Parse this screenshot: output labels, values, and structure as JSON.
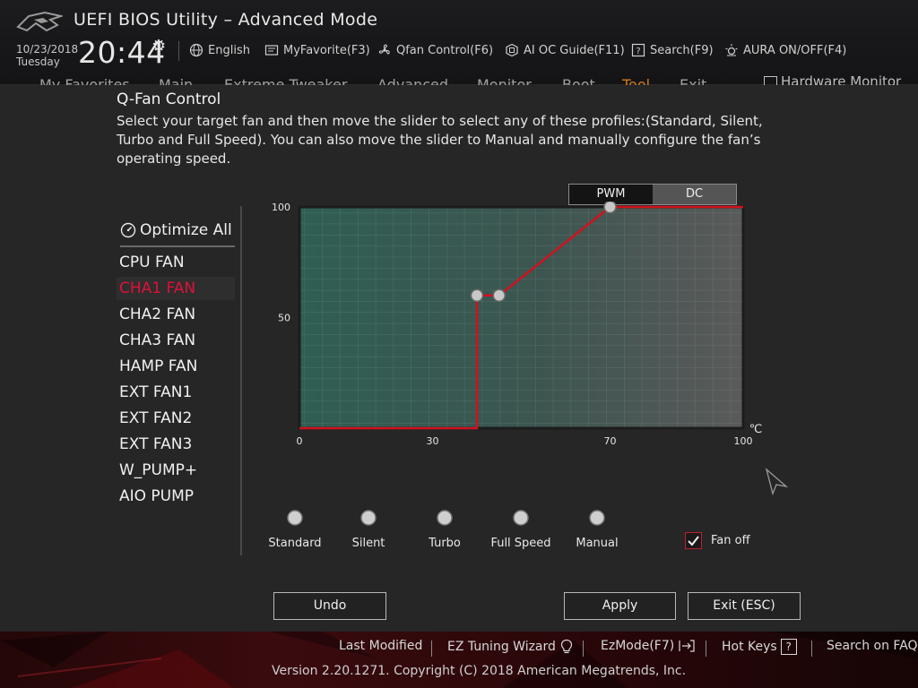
{
  "header": {
    "title": "UEFI BIOS Utility – Advanced Mode",
    "date": "10/23/2018",
    "day": "Tuesday",
    "time": "20:44",
    "tools": [
      {
        "label": "English",
        "icon": "globe-icon"
      },
      {
        "label": "MyFavorite(F3)",
        "icon": "favorite-icon"
      },
      {
        "label": "Qfan Control(F6)",
        "icon": "fan-icon"
      },
      {
        "label": "AI OC Guide(F11)",
        "icon": "ai-oc-icon"
      },
      {
        "label": "Search(F9)",
        "icon": "search-help-icon"
      },
      {
        "label": "AURA ON/OFF(F4)",
        "icon": "aura-icon"
      }
    ],
    "menu": [
      "My Favorites",
      "Main",
      "Extreme Tweaker",
      "Advanced",
      "Monitor",
      "Boot",
      "Tool",
      "Exit"
    ],
    "menu_active": "Tool",
    "hardware_monitor": "Hardware Monitor"
  },
  "qfan": {
    "title": "Q-Fan Control",
    "description": "Select your target fan and then move the slider to select any of these profiles:(Standard, Silent, Turbo and Full Speed). You can also move the slider to Manual and manually configure the fan’s operating speed.",
    "optimize_all": "Optimize All",
    "fans": [
      "CPU FAN",
      "CHA1 FAN",
      "CHA2 FAN",
      "CHA3 FAN",
      "HAMP FAN",
      "EXT FAN1",
      "EXT FAN2",
      "EXT FAN3",
      "W_PUMP+",
      "AIO PUMP"
    ],
    "selected_fan": "CHA1 FAN",
    "mode_options": [
      "PWM",
      "DC"
    ],
    "mode_selected": "PWM",
    "profiles": [
      "Standard",
      "Silent",
      "Turbo",
      "Full Speed",
      "Manual"
    ],
    "profile_selected": "Manual",
    "fan_off_label": "Fan off",
    "fan_off_checked": true,
    "undo": "Undo",
    "apply": "Apply",
    "exit": "Exit (ESC)"
  },
  "chart_data": {
    "type": "line",
    "xlabel": "℃",
    "ylabel": "%",
    "x_ticks": [
      "0",
      "30",
      "70",
      "100"
    ],
    "y_ticks": [
      "100",
      "50"
    ],
    "xlim": [
      0,
      100
    ],
    "ylim": [
      0,
      100
    ],
    "series": [
      {
        "points": [
          [
            0,
            0
          ],
          [
            40,
            0
          ],
          [
            40,
            60
          ],
          [
            45,
            60
          ],
          [
            70,
            100
          ],
          [
            100,
            100
          ]
        ]
      }
    ],
    "handles": [
      [
        40,
        60
      ],
      [
        45,
        60
      ],
      [
        70,
        100
      ]
    ],
    "colors": {
      "line": "#d0121e",
      "handle": "#c8c8c8"
    }
  },
  "footer": {
    "links": [
      "Last Modified",
      "EZ Tuning Wizard",
      "EzMode(F7)",
      "Hot Keys",
      "Search on FAQ"
    ],
    "version": "Version 2.20.1271. Copyright (C) 2018 American Megatrends, Inc."
  },
  "colors": {
    "accent_red": "#e0103a",
    "curve_red": "#d0121e",
    "active_menu": "#d27a1a"
  }
}
